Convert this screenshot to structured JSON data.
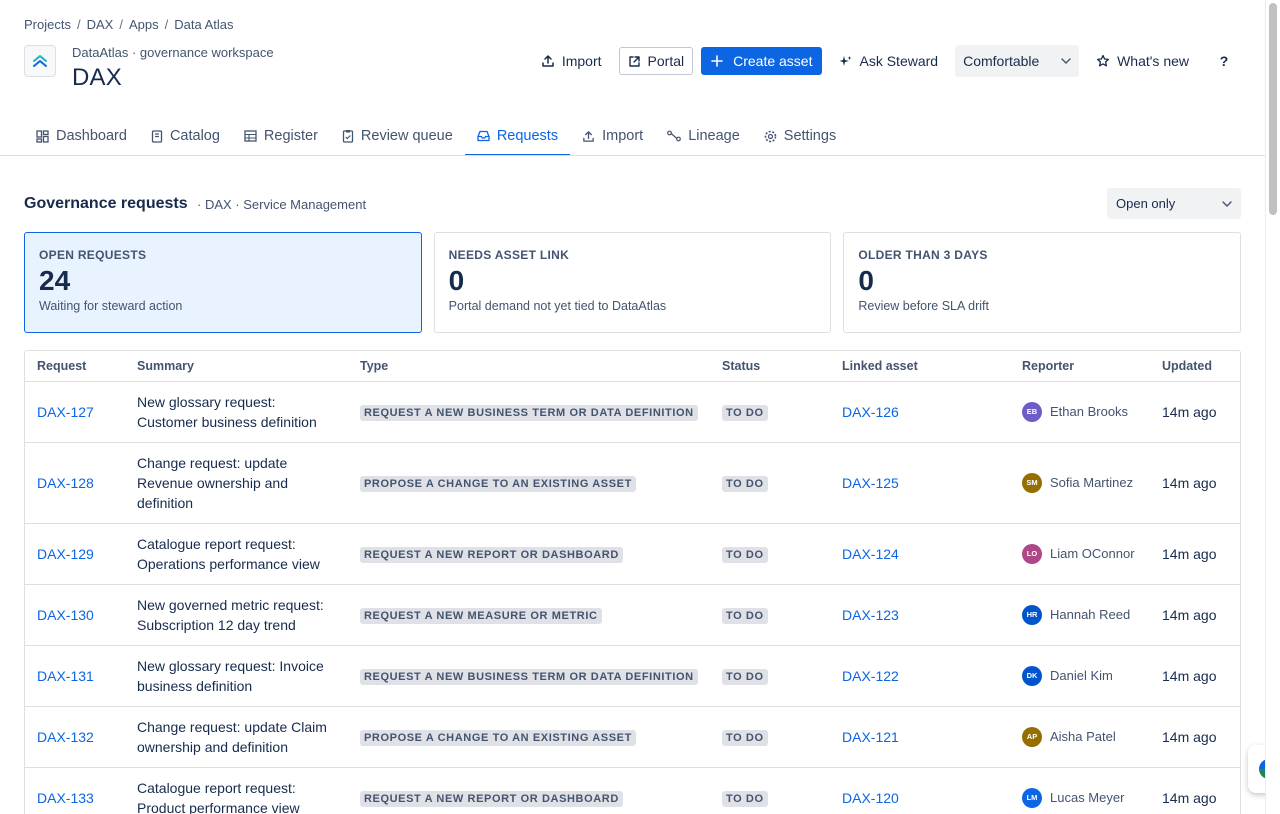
{
  "breadcrumb": [
    "Projects",
    "DAX",
    "Apps",
    "Data Atlas"
  ],
  "header": {
    "subtitle": "DataAtlas · governance workspace",
    "title": "DAX",
    "import_label": "Import",
    "portal_label": "Portal",
    "create_label": "Create asset",
    "ask_label": "Ask Steward",
    "density_value": "Comfortable",
    "whats_new_label": "What's new",
    "help_label": "?"
  },
  "tabs": [
    {
      "label": "Dashboard",
      "icon": "dashboard-icon"
    },
    {
      "label": "Catalog",
      "icon": "book-icon"
    },
    {
      "label": "Register",
      "icon": "table-icon"
    },
    {
      "label": "Review queue",
      "icon": "clipboard-icon"
    },
    {
      "label": "Requests",
      "icon": "inbox-icon"
    },
    {
      "label": "Import",
      "icon": "upload-icon"
    },
    {
      "label": "Lineage",
      "icon": "lineage-icon"
    },
    {
      "label": "Settings",
      "icon": "gear-icon"
    }
  ],
  "active_tab": "Requests",
  "section": {
    "title": "Governance requests",
    "meta": "· DAX · Service Management",
    "filter_value": "Open only"
  },
  "cards": [
    {
      "label": "OPEN REQUESTS",
      "value": "24",
      "desc": "Waiting for steward action"
    },
    {
      "label": "NEEDS ASSET LINK",
      "value": "0",
      "desc": "Portal demand not yet tied to DataAtlas"
    },
    {
      "label": "OLDER THAN 3 DAYS",
      "value": "0",
      "desc": "Review before SLA drift"
    }
  ],
  "table": {
    "columns": [
      "Request",
      "Summary",
      "Type",
      "Status",
      "Linked asset",
      "Reporter",
      "Updated"
    ],
    "rows": [
      {
        "key": "DAX-127",
        "summary": "New glossary request: Customer business definition",
        "type": "REQUEST A NEW BUSINESS TERM OR DATA DEFINITION",
        "status": "TO DO",
        "linked": "DAX-126",
        "initials": "EB",
        "reporter": "Ethan Brooks",
        "avatar_color": "#6e5dc6",
        "updated": "14m ago"
      },
      {
        "key": "DAX-128",
        "summary": "Change request: update Revenue ownership and definition",
        "type": "PROPOSE A CHANGE TO AN EXISTING ASSET",
        "status": "TO DO",
        "linked": "DAX-125",
        "initials": "SM",
        "reporter": "Sofia Martinez",
        "avatar_color": "#946f00",
        "updated": "14m ago"
      },
      {
        "key": "DAX-129",
        "summary": "Catalogue report request: Operations performance view",
        "type": "REQUEST A NEW REPORT OR DASHBOARD",
        "status": "TO DO",
        "linked": "DAX-124",
        "initials": "LO",
        "reporter": "Liam OConnor",
        "avatar_color": "#ae4787",
        "updated": "14m ago"
      },
      {
        "key": "DAX-130",
        "summary": "New governed metric request: Subscription 12 day trend",
        "type": "REQUEST A NEW MEASURE OR METRIC",
        "status": "TO DO",
        "linked": "DAX-123",
        "initials": "HR",
        "reporter": "Hannah Reed",
        "avatar_color": "#0055cc",
        "updated": "14m ago"
      },
      {
        "key": "DAX-131",
        "summary": "New glossary request: Invoice business definition",
        "type": "REQUEST A NEW BUSINESS TERM OR DATA DEFINITION",
        "status": "TO DO",
        "linked": "DAX-122",
        "initials": "DK",
        "reporter": "Daniel Kim",
        "avatar_color": "#0055cc",
        "updated": "14m ago"
      },
      {
        "key": "DAX-132",
        "summary": "Change request: update Claim ownership and definition",
        "type": "PROPOSE A CHANGE TO AN EXISTING ASSET",
        "status": "TO DO",
        "linked": "DAX-121",
        "initials": "AP",
        "reporter": "Aisha Patel",
        "avatar_color": "#946f00",
        "updated": "14m ago"
      },
      {
        "key": "DAX-133",
        "summary": "Catalogue report request: Product performance view",
        "type": "REQUEST A NEW REPORT OR DASHBOARD",
        "status": "TO DO",
        "linked": "DAX-120",
        "initials": "LM",
        "reporter": "Lucas Meyer",
        "avatar_color": "#0c66e4",
        "updated": "14m ago"
      }
    ]
  },
  "colors": {
    "accent": "#0c66e4",
    "card_active_bg": "#e9f2ff",
    "text": "#172b4d",
    "subtle": "#44546f"
  }
}
